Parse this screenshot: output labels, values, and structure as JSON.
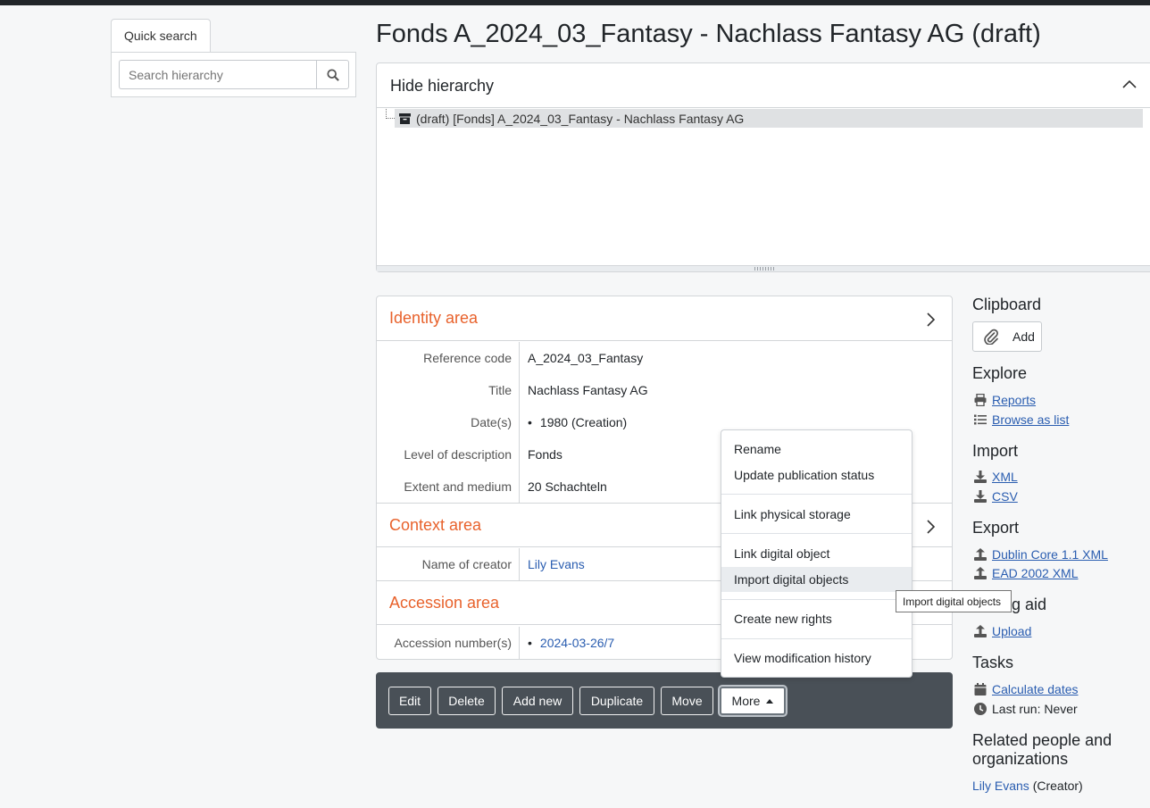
{
  "quick_search": {
    "tab_label": "Quick search",
    "placeholder": "Search hierarchy",
    "search_icon": "search-icon"
  },
  "page_title": "Fonds A_2024_03_Fantasy - Nachlass Fantasy AG (draft)",
  "hierarchy": {
    "toggle_label": "Hide hierarchy",
    "tree_item": "(draft) [Fonds] A_2024_03_Fantasy - Nachlass Fantasy AG"
  },
  "identity_area": {
    "title": "Identity area",
    "fields": [
      {
        "label": "Reference code",
        "value": "A_2024_03_Fantasy"
      },
      {
        "label": "Title",
        "value": "Nachlass Fantasy AG"
      },
      {
        "label": "Date(s)",
        "value": "1980 (Creation)"
      },
      {
        "label": "Level of description",
        "value": "Fonds"
      },
      {
        "label": "Extent and medium",
        "value": "20 Schachteln"
      }
    ]
  },
  "context_area": {
    "title": "Context area",
    "creator_label": "Name of creator",
    "creator_value": "Lily Evans"
  },
  "accession_area": {
    "title": "Accession area",
    "label": "Accession number(s)",
    "value": "2024-03-26/7"
  },
  "actions": {
    "edit": "Edit",
    "delete": "Delete",
    "add_new": "Add new",
    "duplicate": "Duplicate",
    "move": "Move",
    "more": "More"
  },
  "more_menu": {
    "items": [
      "Rename",
      "Update publication status",
      "Link physical storage",
      "Link digital object",
      "Import digital objects",
      "Create new rights",
      "View modification history"
    ],
    "active_item": "Import digital objects",
    "tooltip": "Import digital objects"
  },
  "sidebar": {
    "clipboard": {
      "title": "Clipboard",
      "add": "Add"
    },
    "explore": {
      "title": "Explore",
      "reports": "Reports",
      "browse": "Browse as list"
    },
    "import": {
      "title": "Import",
      "xml": "XML",
      "csv": "CSV"
    },
    "export": {
      "title": "Export",
      "dc": "Dublin Core 1.1 XML",
      "ead": "EAD 2002 XML"
    },
    "finding_aid": {
      "title_visible": "g aid",
      "upload": "Upload"
    },
    "tasks": {
      "title": "Tasks",
      "calc": "Calculate dates",
      "last_run": "Last run: Never"
    },
    "related": {
      "title_line1": "Related people and",
      "title_line2": "organizations",
      "person": "Lily Evans",
      "role": "(Creator)"
    }
  },
  "colors": {
    "accent_orange": "#e8622c",
    "link_blue": "#2a5db0",
    "action_bar": "#495057"
  }
}
